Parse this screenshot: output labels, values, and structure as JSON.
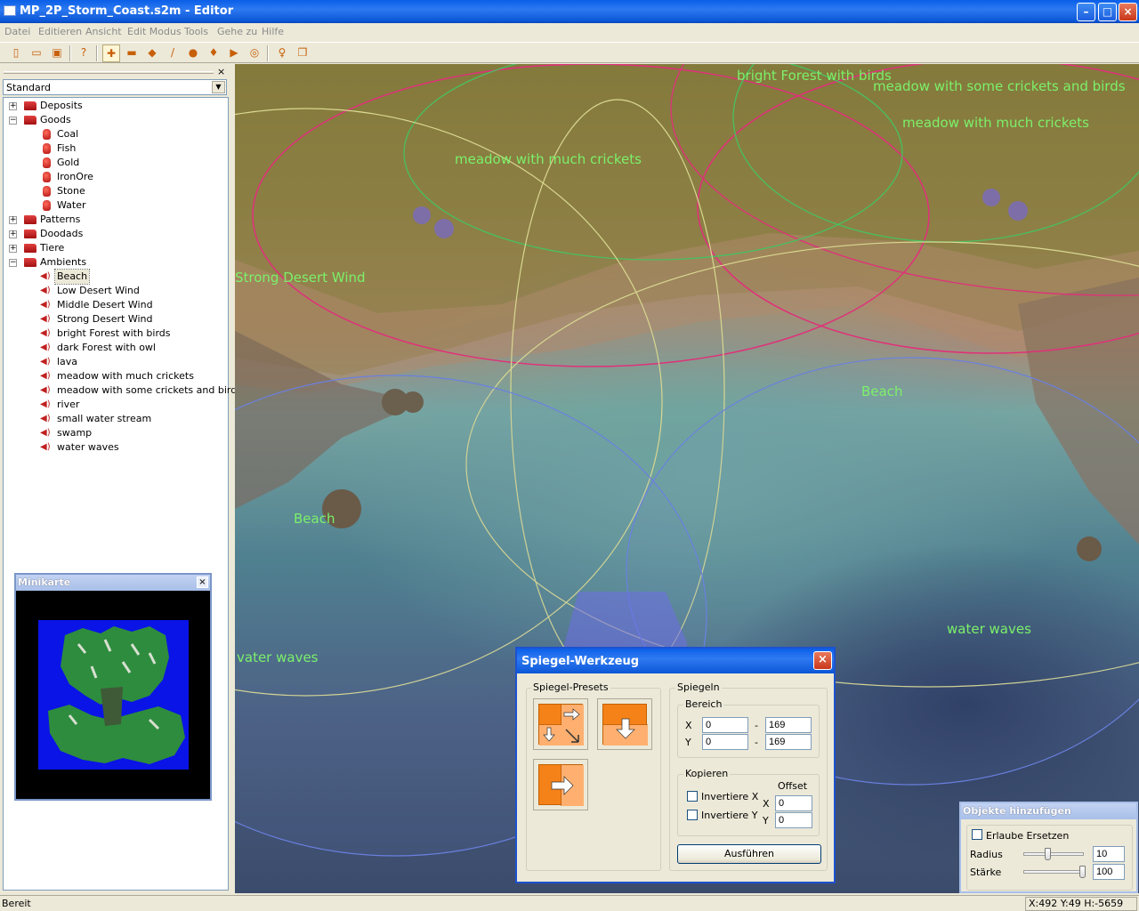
{
  "window": {
    "title": "MP_2P_Storm_Coast.s2m - Editor"
  },
  "menu": [
    "Datei",
    "Editieren",
    "Ansicht",
    "Edit Modus",
    "Tools",
    "Gehe zu",
    "Hilfe"
  ],
  "left_panel": {
    "dropdown_value": "Standard",
    "close_glyph": "×",
    "tree": [
      {
        "label": "Deposits",
        "level": 0,
        "type": "folder",
        "expanded": false
      },
      {
        "label": "Goods",
        "level": 0,
        "type": "folder",
        "expanded": true
      },
      {
        "label": "Coal",
        "level": 1,
        "type": "jar"
      },
      {
        "label": "Fish",
        "level": 1,
        "type": "jar"
      },
      {
        "label": "Gold",
        "level": 1,
        "type": "jar"
      },
      {
        "label": "IronOre",
        "level": 1,
        "type": "jar"
      },
      {
        "label": "Stone",
        "level": 1,
        "type": "jar"
      },
      {
        "label": "Water",
        "level": 1,
        "type": "jar"
      },
      {
        "label": "Patterns",
        "level": 0,
        "type": "folder",
        "expanded": false
      },
      {
        "label": "Doodads",
        "level": 0,
        "type": "folder",
        "expanded": false
      },
      {
        "label": "Tiere",
        "level": 0,
        "type": "folder",
        "expanded": false
      },
      {
        "label": "Ambients",
        "level": 0,
        "type": "folder",
        "expanded": true
      },
      {
        "label": "Beach",
        "level": 1,
        "type": "speaker",
        "selected": true
      },
      {
        "label": "Low Desert Wind",
        "level": 1,
        "type": "speaker"
      },
      {
        "label": "Middle Desert Wind",
        "level": 1,
        "type": "speaker"
      },
      {
        "label": "Strong Desert Wind",
        "level": 1,
        "type": "speaker"
      },
      {
        "label": "bright Forest with birds",
        "level": 1,
        "type": "speaker"
      },
      {
        "label": "dark Forest with owl",
        "level": 1,
        "type": "speaker"
      },
      {
        "label": "lava",
        "level": 1,
        "type": "speaker"
      },
      {
        "label": "meadow with much crickets",
        "level": 1,
        "type": "speaker"
      },
      {
        "label": "meadow with some crickets and birds",
        "level": 1,
        "type": "speaker"
      },
      {
        "label": "river",
        "level": 1,
        "type": "speaker"
      },
      {
        "label": "small water stream",
        "level": 1,
        "type": "speaker"
      },
      {
        "label": "swamp",
        "level": 1,
        "type": "speaker"
      },
      {
        "label": "water waves",
        "level": 1,
        "type": "speaker"
      }
    ]
  },
  "minimap": {
    "title": "Minikarte",
    "close_glyph": "×"
  },
  "viewport_labels": [
    {
      "text": "bright Forest with birds"
    },
    {
      "text": "meadow with some crickets and birds"
    },
    {
      "text": "meadow with much crickets"
    },
    {
      "text": "meadow with much crickets"
    },
    {
      "text": "Strong Desert Wind"
    },
    {
      "text": "Beach"
    },
    {
      "text": "Beach"
    },
    {
      "text": "water waves"
    },
    {
      "text": "vater waves"
    }
  ],
  "mirror_dialog": {
    "title": "Spiegel-Werkzeug",
    "close_glyph": "×",
    "presets_label": "Spiegel-Presets",
    "mirror_label": "Spiegeln",
    "range_label": "Bereich",
    "x_label": "X",
    "y_label": "Y",
    "dash": "-",
    "x_from": "0",
    "x_to": "169",
    "y_from": "0",
    "y_to": "169",
    "copy_label": "Kopieren",
    "offset_label": "Offset",
    "invert_x": "Invertiere X",
    "invert_y": "Invertiere Y",
    "offset_x": "0",
    "offset_y": "0",
    "execute_label": "Ausführen"
  },
  "objects_panel": {
    "title": "Objekte hinzufügen",
    "allow_replace": "Erlaube Ersetzen",
    "radius_label": "Radius",
    "radius_value": "10",
    "strength_label": "Stärke",
    "strength_value": "100"
  },
  "status": {
    "left": "Bereit",
    "right": "X:492 Y:49 H:-5659"
  },
  "colors": {
    "accent": "#0a5fe8",
    "label_green": "#7cf06a",
    "preset_orange": "#f58218"
  }
}
